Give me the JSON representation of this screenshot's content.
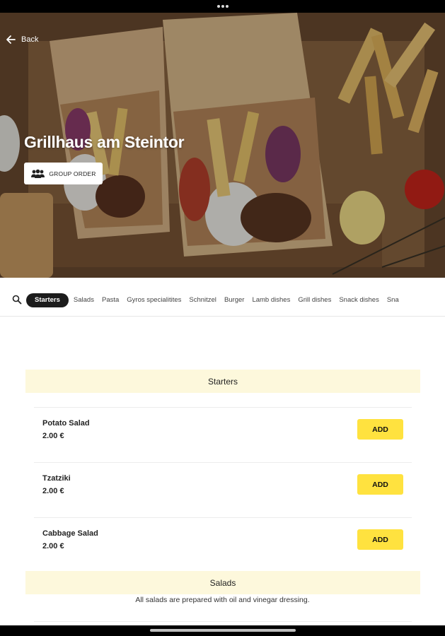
{
  "app": {
    "back_label": "Back",
    "restaurant_name": "Grillhaus am Steintor",
    "group_order_label": "GROUP ORDER"
  },
  "icons": {
    "back": "arrow-left-icon",
    "group": "group-icon",
    "search": "search-icon"
  },
  "categories": [
    {
      "label": "Starters",
      "active": true
    },
    {
      "label": "Salads",
      "active": false
    },
    {
      "label": "Pasta",
      "active": false
    },
    {
      "label": "Gyros specialitites",
      "active": false
    },
    {
      "label": "Schnitzel",
      "active": false
    },
    {
      "label": "Burger",
      "active": false
    },
    {
      "label": "Lamb dishes",
      "active": false
    },
    {
      "label": "Grill dishes",
      "active": false
    },
    {
      "label": "Snack dishes",
      "active": false
    },
    {
      "label": "Sna",
      "active": false
    }
  ],
  "sections": [
    {
      "title": "Starters",
      "items": [
        {
          "name": "Potato Salad",
          "price": "2.00 €",
          "add_label": "ADD"
        },
        {
          "name": "Tzatziki",
          "price": "2.00 €",
          "add_label": "ADD"
        },
        {
          "name": "Cabbage Salad",
          "price": "2.00 €",
          "add_label": "ADD"
        }
      ]
    },
    {
      "title": "Salads",
      "description": "All salads are prepared with oil and vinegar dressing."
    }
  ],
  "colors": {
    "accent_add": "#ffe23f",
    "section_header_bg": "#fdf8dc",
    "active_chip_bg": "#1c1c1c"
  }
}
